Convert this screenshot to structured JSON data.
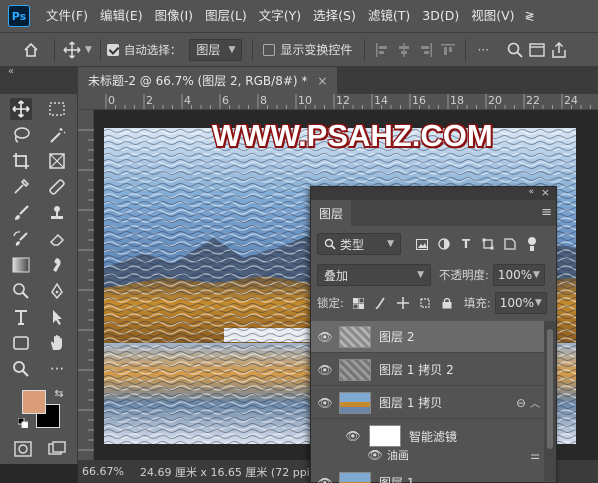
{
  "app": {
    "logo": "Ps"
  },
  "menu": {
    "items": [
      "文件(F)",
      "编辑(E)",
      "图像(I)",
      "图层(L)",
      "文字(Y)",
      "选择(S)",
      "滤镜(T)",
      "3D(D)",
      "视图(V)"
    ],
    "more": "≷"
  },
  "options": {
    "auto_select_label": "自动选择：",
    "auto_select_value": "图层",
    "show_transform_label": "显示变换控件"
  },
  "document": {
    "tab_title": "未标题-2 @ 66.7% (图层 2, RGB/8#) *",
    "close": "×",
    "watermark": "WWW.PSAHZ.COM"
  },
  "ruler": {
    "ticks": [
      "0",
      "2",
      "4",
      "6",
      "8",
      "10",
      "12",
      "14",
      "16",
      "18",
      "20",
      "22",
      "24"
    ]
  },
  "status": {
    "zoom": "66.67%",
    "doc_size": "24.69 厘米 x 16.65 厘米 (72 ppi)",
    "arrow": "〉"
  },
  "colors": {
    "foreground": "#d99e79",
    "background": "#000000"
  },
  "layers_panel": {
    "title": "图层",
    "filter_kind": "类型",
    "blend_mode": "叠加",
    "opacity_label": "不透明度:",
    "opacity_value": "100%",
    "lock_label": "锁定:",
    "fill_label": "填充:",
    "fill_value": "100%",
    "layers": [
      {
        "name": "图层 2",
        "selected": true
      },
      {
        "name": "图层 1 拷贝 2",
        "selected": false
      },
      {
        "name": "图层 1 拷贝",
        "selected": false
      },
      {
        "name": "智能滤镜",
        "selected": false
      },
      {
        "name": "油画",
        "selected": false
      },
      {
        "name": "图层 1",
        "selected": false
      }
    ]
  }
}
